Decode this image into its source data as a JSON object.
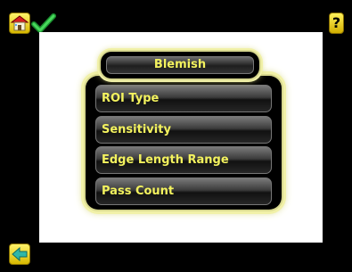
{
  "screen": {
    "title": "Blemish",
    "help_label": "?"
  },
  "menu": {
    "items": [
      {
        "label": "ROI Type"
      },
      {
        "label": "Sensitivity"
      },
      {
        "label": "Edge Length Range"
      },
      {
        "label": "Pass Count"
      }
    ]
  },
  "icons": {
    "home": "home-icon",
    "check": "check-icon",
    "help": "help-icon",
    "back": "back-arrow-icon"
  },
  "colors": {
    "accent_text": "#f3f25e",
    "button_yellow": "#f1d400",
    "check_green": "#2ec43f",
    "panel_background": "#ffffff",
    "screen_background": "#000000"
  }
}
